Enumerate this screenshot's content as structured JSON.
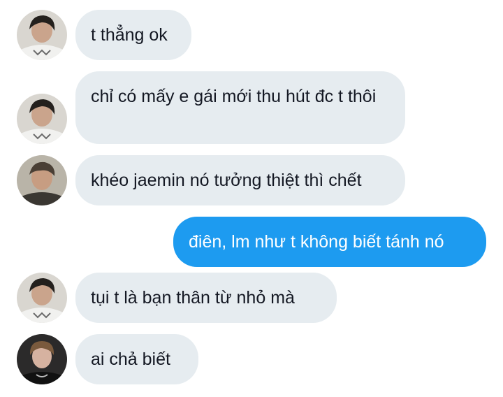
{
  "conversation": {
    "messages": [
      {
        "direction": "incoming",
        "avatar": "avatar-a-icon",
        "text": "t thẳng ok"
      },
      {
        "direction": "incoming",
        "avatar": "avatar-a-icon",
        "text": "chỉ có mấy e gái mới thu hút đc t thôi"
      },
      {
        "direction": "incoming",
        "avatar": "avatar-b-icon",
        "text": "khéo jaemin nó tưởng thiệt thì chết"
      },
      {
        "direction": "outgoing",
        "avatar": "",
        "text": "điên, lm như t không biết tánh nó"
      },
      {
        "direction": "incoming",
        "avatar": "avatar-a-icon",
        "text": "tụi t là bạn thân từ nhỏ mà"
      },
      {
        "direction": "incoming",
        "avatar": "avatar-c-icon",
        "text": "ai chả biết"
      }
    ]
  },
  "colors": {
    "incoming_bubble": "#e6ecf0",
    "outgoing_bubble": "#1d9bf0",
    "incoming_text": "#141823",
    "outgoing_text": "#ffffff"
  }
}
